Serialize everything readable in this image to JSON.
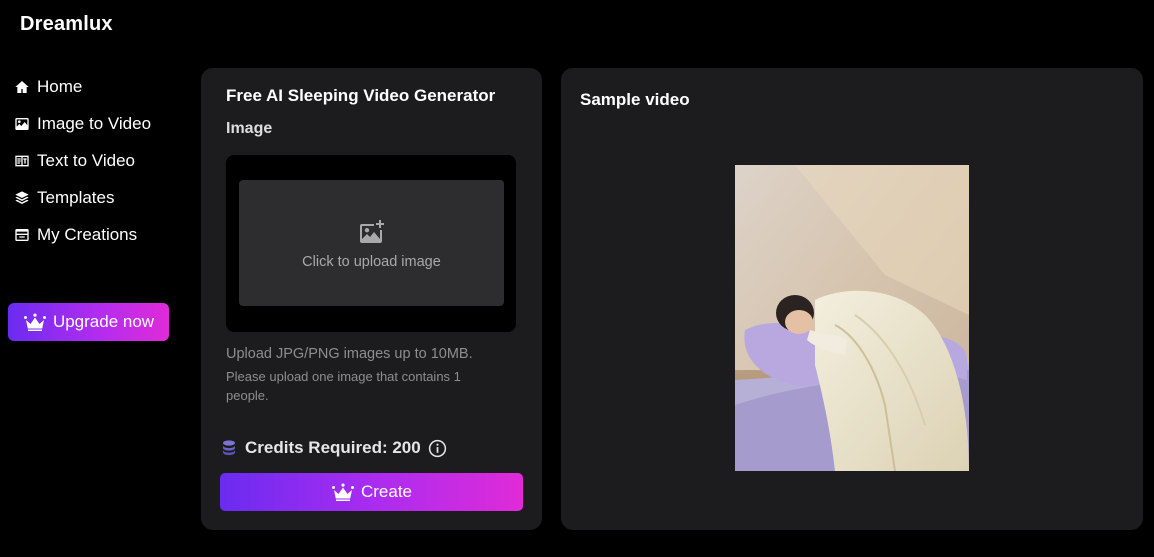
{
  "brand": {
    "name": "Dreamlux"
  },
  "sidebar": {
    "items": [
      {
        "label": "Home",
        "icon": "home-icon"
      },
      {
        "label": "Image to Video",
        "icon": "image-icon"
      },
      {
        "label": "Text to Video",
        "icon": "text-video-icon"
      },
      {
        "label": "Templates",
        "icon": "layers-icon"
      },
      {
        "label": "My Creations",
        "icon": "archive-icon"
      }
    ],
    "upgrade_label": "Upgrade now"
  },
  "generator": {
    "title": "Free AI Sleeping Video Generator",
    "image_label": "Image",
    "upload_text": "Click to upload image",
    "hint_primary": "Upload JPG/PNG images up to 10MB.",
    "hint_secondary": "Please upload one image that contains 1 people.",
    "credits_label": "Credits Required: 200",
    "create_label": "Create"
  },
  "sample": {
    "title": "Sample video"
  },
  "colors": {
    "background": "#000000",
    "panel": "#1c1c1e",
    "gradient_start": "#6a2cf0",
    "gradient_end": "#e02bd8",
    "muted_text": "#8e8e90"
  }
}
